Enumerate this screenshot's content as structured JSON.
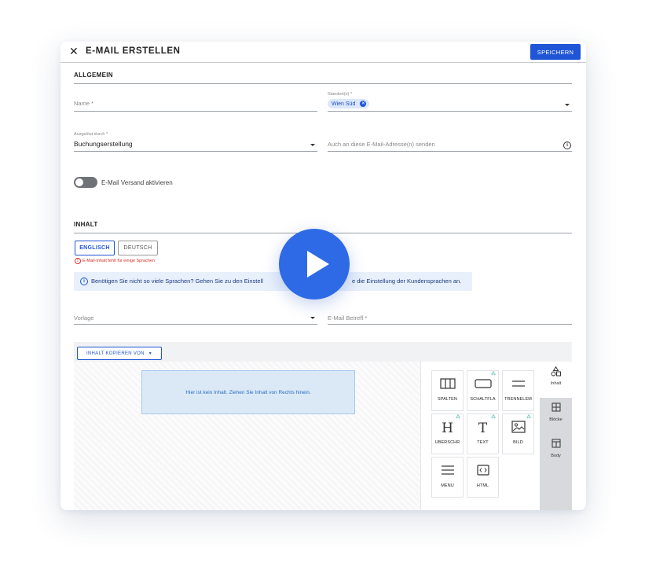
{
  "header": {
    "title": "E-MAIL ERSTELLEN",
    "close_glyph": "✕",
    "save_label": "SPEICHERN"
  },
  "general": {
    "section_title": "ALLGEMEIN",
    "name_placeholder": "Name *",
    "location_label": "Standort(e) *",
    "location_chip": "Wien Süd",
    "triggered_label": "Ausgelöst durch *",
    "triggered_value": "Buchungserstellung",
    "cc_placeholder": "Auch an diese E-Mail-Adresse(n) senden",
    "toggle_label": "E-Mail Versand aktivieren",
    "toggle_on": false
  },
  "content": {
    "section_title": "INHALT",
    "languages": [
      "ENGLISCH",
      "DEUTSCH"
    ],
    "active_language": "ENGLISCH",
    "error": "E-Mail-Inhalt fehlt für einige Sprachen",
    "banner_left": "Benötigen Sie nicht so viele Sprachen? Gehen Sie zu den Einstell",
    "banner_right": "e die Einstellung der Kundensprachen an.",
    "template_placeholder": "Vorlage",
    "subject_placeholder": "E-Mail Betreff *"
  },
  "editor": {
    "copy_button": "INHALT KOPIEREN VON",
    "empty_message": "Hier ist kein Inhalt. Ziehen Sie Inhalt von Rechts hinein.",
    "tiles": [
      {
        "label": "SPALTEN",
        "icon": "columns-icon"
      },
      {
        "label": "SCHALTFLÄ",
        "icon": "button-icon"
      },
      {
        "label": "TRENNELEM",
        "icon": "divider-icon"
      },
      {
        "label": "ÜBERSCHR",
        "icon": "heading-icon"
      },
      {
        "label": "TEXT",
        "icon": "text-icon"
      },
      {
        "label": "BILD",
        "icon": "image-icon"
      },
      {
        "label": "MENÜ",
        "icon": "menu-icon"
      },
      {
        "label": "HTML",
        "icon": "html-icon"
      }
    ],
    "side_tabs": [
      "Inhalt",
      "Blöcke",
      "Body"
    ],
    "active_side_tab": "Inhalt"
  },
  "colors": {
    "accent": "#1f55d6",
    "error": "#d93025",
    "play": "#2f6ae6"
  },
  "overlay": {
    "icon": "play-icon"
  }
}
